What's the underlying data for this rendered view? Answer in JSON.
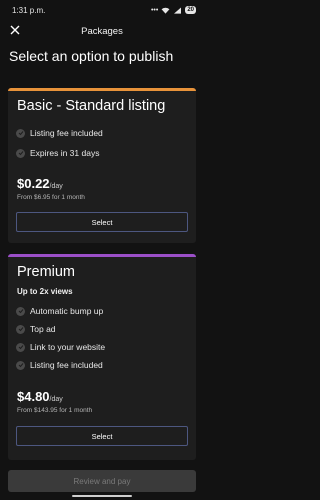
{
  "status_bar": {
    "time": "1:31 p.m.",
    "battery": "20"
  },
  "header": {
    "title": "Packages",
    "close_icon": "close-icon"
  },
  "heading": "Select an option to publish",
  "packages": [
    {
      "title": "Basic - Standard listing",
      "accent_color": "#e8933a",
      "features": [
        "Listing fee included",
        "Expires in 31 days"
      ],
      "price": "$0.22",
      "price_unit": "/day",
      "price_sub": "From $6.95 for 1 month",
      "select_label": "Select"
    },
    {
      "title": "Premium",
      "subtitle": "Up to 2x views",
      "accent_color": "#9b4fc8",
      "features": [
        "Automatic bump up",
        "Top ad",
        "Link to your website",
        "Listing fee included"
      ],
      "price": "$4.80",
      "price_unit": "/day",
      "price_sub": "From $143.95 for 1 month",
      "select_label": "Select"
    }
  ],
  "footer": {
    "review_label": "Review and pay"
  },
  "colors": {
    "background": "#121212",
    "card": "#1e1e1e",
    "button_border": "#4d5780"
  }
}
